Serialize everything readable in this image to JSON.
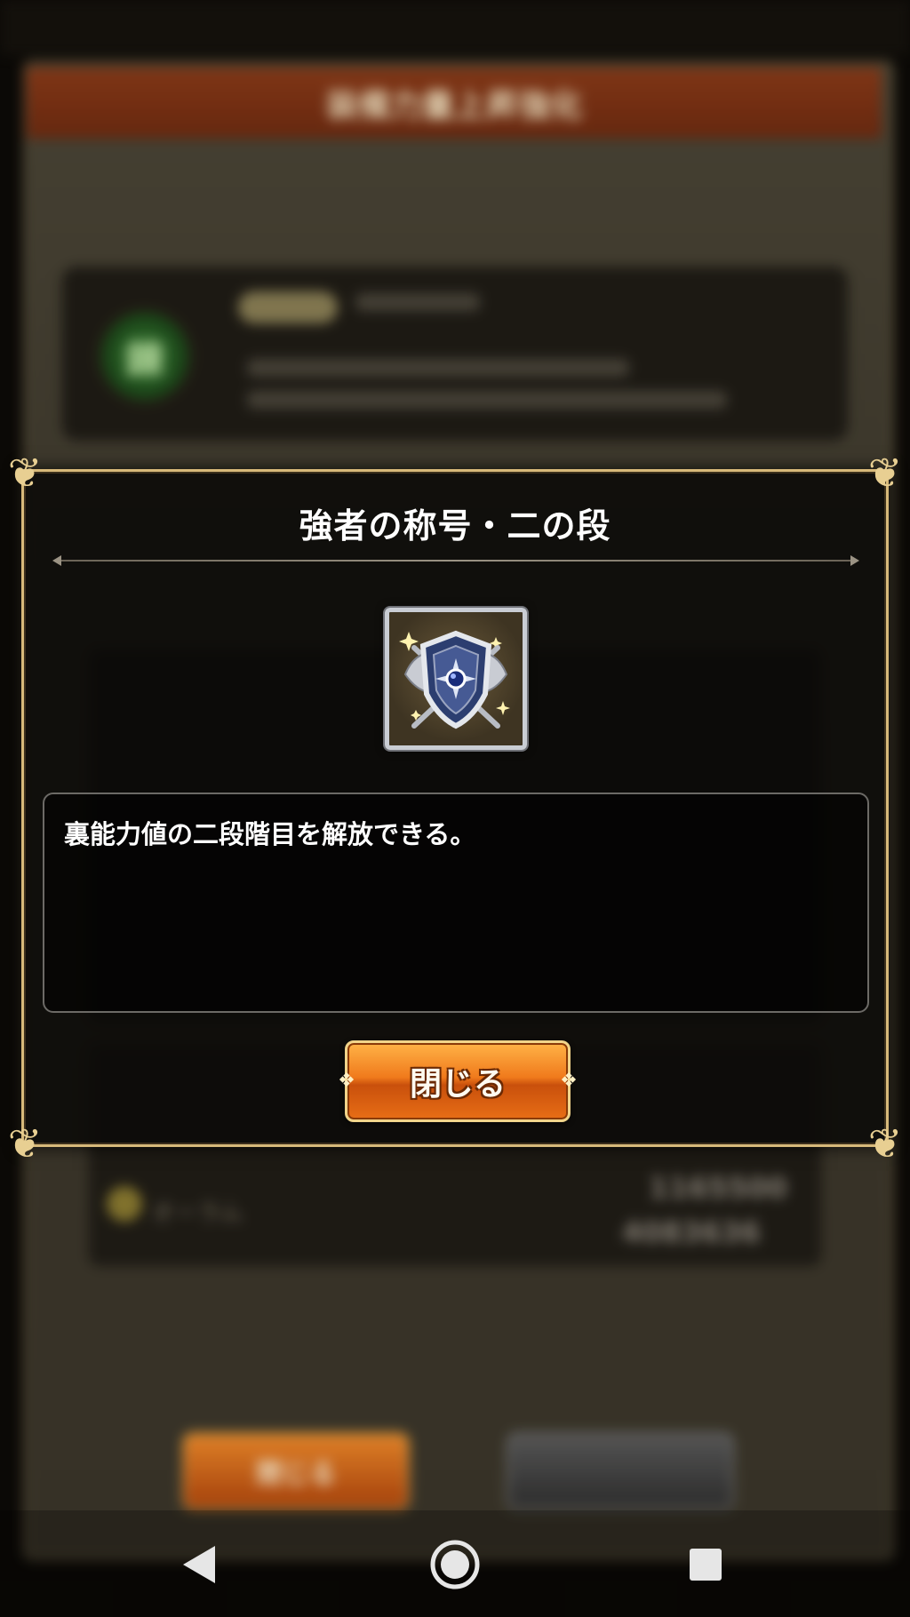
{
  "background": {
    "header_title": "装備力量上昇強化",
    "top_card_orb_glyph": "錬",
    "aura_label": "オーラム",
    "stat_values": [
      "1165500",
      "4083636"
    ],
    "left_button_label": "閉じる"
  },
  "dialog": {
    "title": "強者の称号・二の段",
    "item_icon": "silver-shield-crest-icon",
    "description": "裏能力値の二段階目を解放できる。",
    "close_button_label": "閉じる"
  },
  "nav_bar": {
    "back_icon": "triangle-back-icon",
    "home_icon": "circle-home-icon",
    "recent_icon": "square-recents-icon"
  },
  "colors": {
    "dialog_border": "#d7b97a",
    "button_orange": "#f07a1c",
    "header_red": "#8a3a18"
  }
}
